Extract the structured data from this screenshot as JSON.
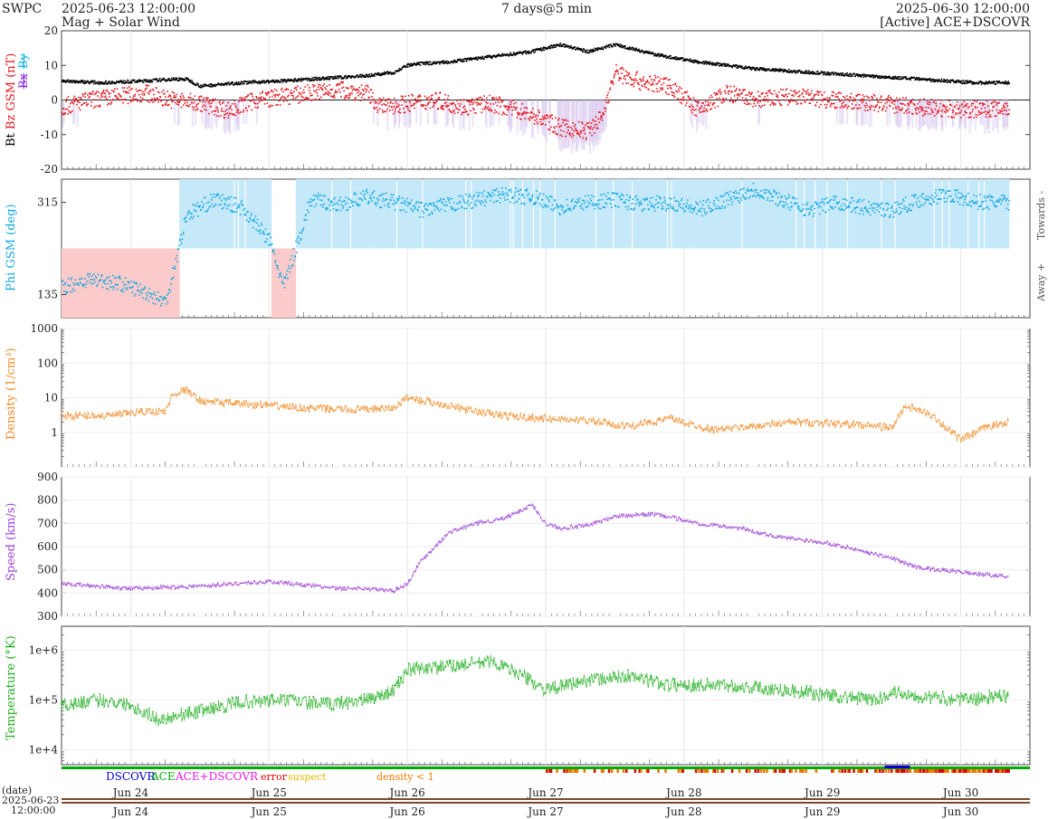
{
  "header": {
    "org": "SWPC",
    "start": "2025-06-23 12:00:00",
    "subtitle": "Mag + Solar Wind",
    "span": "7 days@5 min",
    "end": "2025-06-30 12:00:00",
    "source": "[Active] ACE+DSCOVR"
  },
  "colors": {
    "bt": "#000000",
    "bz": "#e8141c",
    "bx": "#8a2be2",
    "by": "#14b4e6",
    "phi": "#14a8e0",
    "towards_fill": "#c6e9fa",
    "away_fill": "#fbcaca",
    "density": "#f08a24",
    "speed": "#9b3fd6",
    "temperature": "#1fae1f",
    "dscovr": "#0000cc",
    "ace": "#00aa00",
    "ace_dscovr": "#e619e6",
    "error": "#e00000",
    "suspect": "#e6b800",
    "density_lt1": "#f07800",
    "bz_neg_fill": "#d8c8f0"
  },
  "chart_data": [
    {
      "panel": "magnetic",
      "type": "scatter",
      "ylabel": "Bt  Bz GSM (nT)",
      "legend_extra": [
        "Bx",
        "By"
      ],
      "ylim": [
        -20,
        20
      ],
      "yticks": [
        -20,
        -10,
        0,
        10,
        20
      ],
      "x_unit": "days since 2025-06-23 12:00",
      "series": [
        {
          "name": "Bt",
          "x": [
            0,
            0.3,
            0.6,
            0.8,
            0.9,
            1.0,
            1.3,
            1.6,
            1.8,
            2.0,
            2.2,
            2.4,
            2.5,
            2.6,
            2.8,
            3.0,
            3.2,
            3.4,
            3.6,
            3.8,
            4.0,
            4.3,
            4.6,
            5.0,
            5.4,
            5.8,
            6.2,
            6.6,
            6.85
          ],
          "values": [
            5.5,
            5,
            5.5,
            6,
            6,
            4,
            5,
            5.5,
            6,
            6.5,
            7,
            8,
            10,
            10.5,
            11,
            12,
            13,
            14,
            16,
            14,
            16,
            13,
            11,
            9,
            8,
            7,
            6,
            5,
            5
          ]
        },
        {
          "name": "Bz",
          "x": [
            0,
            0.2,
            0.4,
            0.6,
            0.8,
            1.0,
            1.2,
            1.4,
            1.6,
            1.8,
            2.0,
            2.2,
            2.3,
            2.5,
            2.7,
            2.9,
            3.1,
            3.3,
            3.5,
            3.6,
            3.8,
            3.9,
            4.0,
            4.2,
            4.4,
            4.6,
            4.8,
            5.0,
            5.3,
            5.6,
            5.9,
            6.2,
            6.5,
            6.85
          ],
          "values": [
            -2,
            0,
            1,
            2,
            0,
            -1,
            -3,
            0,
            1,
            2,
            3,
            2,
            -2,
            -1,
            0,
            -2,
            -1,
            -3,
            -6,
            -8,
            -9,
            -5,
            8,
            5,
            4,
            -3,
            2,
            0,
            1,
            0,
            -1,
            -2,
            -3,
            -2
          ]
        }
      ]
    },
    {
      "panel": "phi",
      "type": "scatter",
      "ylabel": "Phi GSM (deg)",
      "yticks": [
        135,
        315
      ],
      "right_labels": [
        "Towards -",
        "Away +"
      ],
      "x_unit": "days since 2025-06-23 12:00",
      "series": [
        {
          "name": "Phi",
          "x": [
            0,
            0.2,
            0.4,
            0.6,
            0.75,
            0.9,
            1.1,
            1.3,
            1.5,
            1.6,
            1.8,
            2.0,
            2.2,
            2.4,
            2.6,
            2.8,
            3.0,
            3.2,
            3.4,
            3.6,
            3.8,
            4.0,
            4.2,
            4.4,
            4.6,
            4.8,
            5.0,
            5.2,
            5.4,
            5.6,
            5.8,
            6.0,
            6.2,
            6.4,
            6.6,
            6.8
          ],
          "values": [
            150,
            165,
            158,
            140,
            120,
            290,
            320,
            305,
            240,
            150,
            320,
            310,
            325,
            315,
            300,
            310,
            320,
            330,
            325,
            305,
            315,
            320,
            310,
            315,
            300,
            320,
            340,
            320,
            300,
            315,
            305,
            300,
            320,
            330,
            315,
            315
          ]
        }
      ]
    },
    {
      "panel": "density",
      "type": "line",
      "ylabel": "Density (1/cm³)",
      "yscale": "log",
      "ylim": [
        0.1,
        1000
      ],
      "ytick_labels": [
        "1",
        "10",
        "100",
        "1000"
      ],
      "x_unit": "days since 2025-06-23 12:00",
      "series": [
        {
          "name": "Density",
          "x": [
            0,
            0.3,
            0.6,
            0.75,
            0.8,
            0.9,
            1.0,
            1.2,
            1.5,
            1.8,
            2.1,
            2.4,
            2.5,
            2.8,
            3.0,
            3.2,
            3.5,
            3.8,
            4.1,
            4.4,
            4.7,
            5.0,
            5.3,
            5.6,
            5.9,
            6.0,
            6.1,
            6.3,
            6.5,
            6.7,
            6.85
          ],
          "values": [
            3,
            3,
            4,
            4,
            12,
            17,
            8,
            7,
            6,
            5,
            4.5,
            5,
            10,
            6,
            4,
            3,
            2.5,
            2.2,
            1.5,
            2.5,
            1.2,
            1.5,
            2,
            1.8,
            1.5,
            1.3,
            6,
            3,
            0.6,
            1.5,
            2
          ]
        }
      ]
    },
    {
      "panel": "speed",
      "type": "line",
      "ylabel": "Speed (km/s)",
      "ylim": [
        300,
        900
      ],
      "yticks": [
        300,
        400,
        500,
        600,
        700,
        800,
        900
      ],
      "x_unit": "days since 2025-06-23 12:00",
      "series": [
        {
          "name": "Speed",
          "x": [
            0,
            0.5,
            1.0,
            1.5,
            2.0,
            2.2,
            2.4,
            2.5,
            2.6,
            2.8,
            3.0,
            3.2,
            3.4,
            3.5,
            3.6,
            3.8,
            4.0,
            4.3,
            4.6,
            4.9,
            5.2,
            5.5,
            5.8,
            6.0,
            6.2,
            6.5,
            6.85
          ],
          "values": [
            440,
            420,
            430,
            450,
            420,
            420,
            410,
            440,
            540,
            660,
            700,
            720,
            780,
            700,
            680,
            690,
            730,
            740,
            700,
            680,
            640,
            620,
            580,
            550,
            510,
            490,
            470
          ]
        }
      ]
    },
    {
      "panel": "temperature",
      "type": "line",
      "ylabel": "Temperature (°K)",
      "yscale": "log",
      "ylim": [
        5000,
        3000000
      ],
      "ytick_labels": [
        "1e+4",
        "1e+5",
        "1e+6"
      ],
      "x_unit": "days since 2025-06-23 12:00",
      "series": [
        {
          "name": "Temperature",
          "x": [
            0,
            0.3,
            0.5,
            0.7,
            1.0,
            1.3,
            1.6,
            1.9,
            2.2,
            2.4,
            2.5,
            2.7,
            2.9,
            3.1,
            3.3,
            3.5,
            3.8,
            4.1,
            4.4,
            4.7,
            5.0,
            5.3,
            5.6,
            5.9,
            6.0,
            6.2,
            6.5,
            6.85
          ],
          "values": [
            80000,
            100000,
            80000,
            40000,
            60000,
            90000,
            100000,
            80000,
            100000,
            150000,
            400000,
            450000,
            500000,
            600000,
            350000,
            150000,
            250000,
            300000,
            200000,
            200000,
            180000,
            150000,
            120000,
            100000,
            150000,
            120000,
            100000,
            120000
          ]
        }
      ]
    }
  ],
  "status_legend": {
    "dscovr": "DSCOVR",
    "ace": "ACE",
    "ace_dscovr": "ACE+DSCOVR",
    "error": "error",
    "suspect": "suspect",
    "density_lt1": "density < 1"
  },
  "x_axis": {
    "labels": [
      "Jun 24",
      "Jun 25",
      "Jun 26",
      "Jun 27",
      "Jun 28",
      "Jun 29",
      "Jun 30"
    ],
    "date_label": "(date)",
    "start_date": "2025-06-23",
    "start_time": "12:00:00"
  }
}
